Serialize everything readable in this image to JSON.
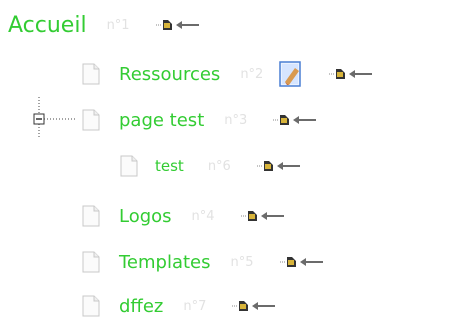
{
  "tree": {
    "root": {
      "label": "Accueil",
      "num": "n°1",
      "icon": "page-move-left-arrow-icon"
    },
    "nodes": [
      {
        "id": "ressources",
        "label": "Ressources",
        "num": "n°2",
        "icon": "page-icon",
        "has_edit": true,
        "edit_icon": "edit-pencil-icon"
      },
      {
        "id": "page-test",
        "label": "page test",
        "num": "n°3",
        "icon": "page-icon",
        "expander": "collapse-minus-icon"
      },
      {
        "id": "test",
        "label": "test",
        "num": "n°6",
        "icon": "page-icon"
      },
      {
        "id": "logos",
        "label": "Logos",
        "num": "n°4",
        "icon": "page-icon"
      },
      {
        "id": "templates",
        "label": "Templates",
        "num": "n°5",
        "icon": "page-icon"
      },
      {
        "id": "dffez",
        "label": "dffez",
        "num": "n°7",
        "icon": "page-icon"
      }
    ]
  },
  "colors": {
    "label": "#33cc33",
    "number": "#e2e2e2",
    "move_icon": "#5a5a5a",
    "edit_icon": "#4a7fd4"
  }
}
